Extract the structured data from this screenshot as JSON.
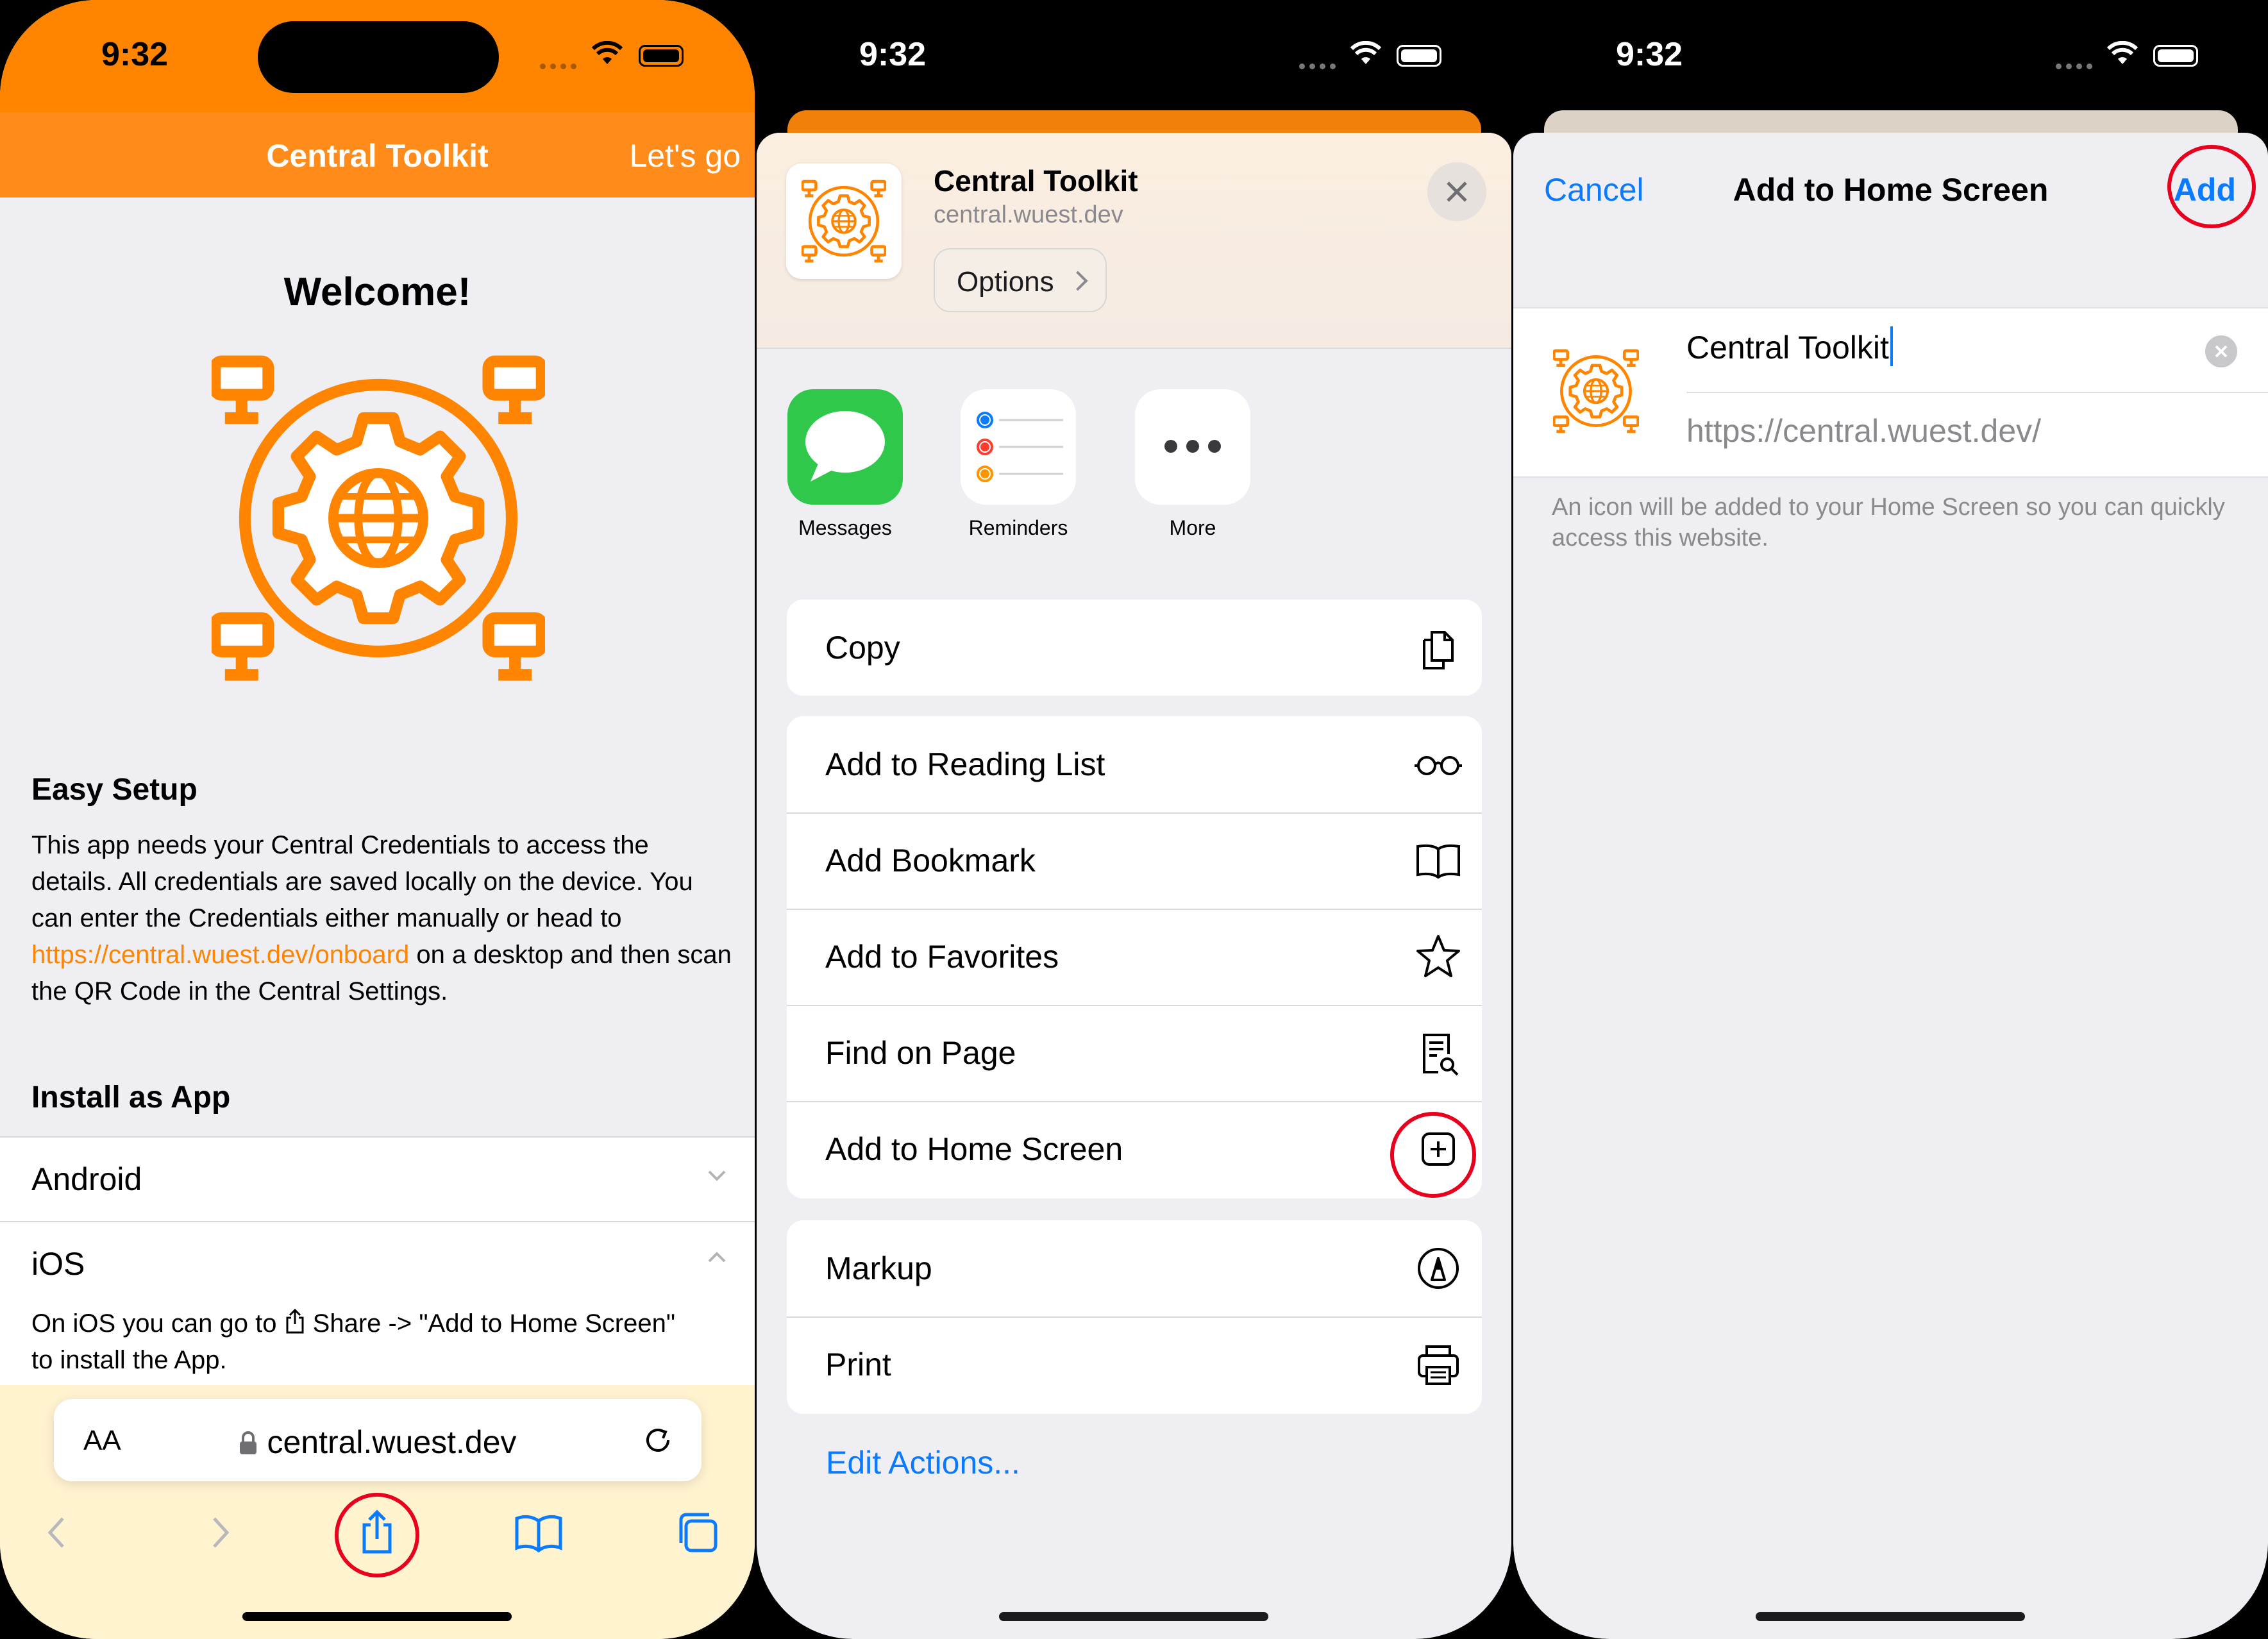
{
  "colors": {
    "accent_orange": "#ff8400",
    "ios_blue": "#0a7aff",
    "highlight_red": "#e8001c"
  },
  "status": {
    "time": "9:32"
  },
  "screen1": {
    "nav_title": "Central Toolkit",
    "nav_action": "Let's go",
    "welcome": "Welcome!",
    "easy_setup": {
      "heading": "Easy Setup",
      "text_before_link": "This app needs your Central Credentials to access the details. All credentials are saved locally on the device. You can enter the Credentials either manually or head to ",
      "link": "https://central.wuest.dev/onboard",
      "text_after_link": " on a desktop and then scan the QR Code in the Central Settings."
    },
    "install": {
      "heading": "Install as App",
      "android_label": "Android",
      "ios_label": "iOS",
      "ios_text_before": "On iOS you can go to ",
      "ios_text_after": " Share -> \"Add to Home Screen\" to install the App."
    },
    "browser": {
      "text_size": "AA",
      "url": "central.wuest.dev"
    }
  },
  "screen2": {
    "title": "Central Toolkit",
    "url": "central.wuest.dev",
    "options_label": "Options",
    "apps": [
      {
        "name": "Messages",
        "icon": "messages-icon"
      },
      {
        "name": "Reminders",
        "icon": "reminders-icon"
      },
      {
        "name": "More",
        "icon": "more-icon"
      }
    ],
    "actions": {
      "copy": "Copy",
      "reading_list": "Add to Reading List",
      "bookmark": "Add Bookmark",
      "favorites": "Add to Favorites",
      "find": "Find on Page",
      "home_screen": "Add to Home Screen",
      "markup": "Markup",
      "print": "Print"
    },
    "edit_actions": "Edit Actions..."
  },
  "screen3": {
    "cancel": "Cancel",
    "title": "Add to Home Screen",
    "add": "Add",
    "name_value": "Central Toolkit",
    "url_value": "https://central.wuest.dev/",
    "hint": "An icon will be added to your Home Screen so you can quickly access this website."
  }
}
